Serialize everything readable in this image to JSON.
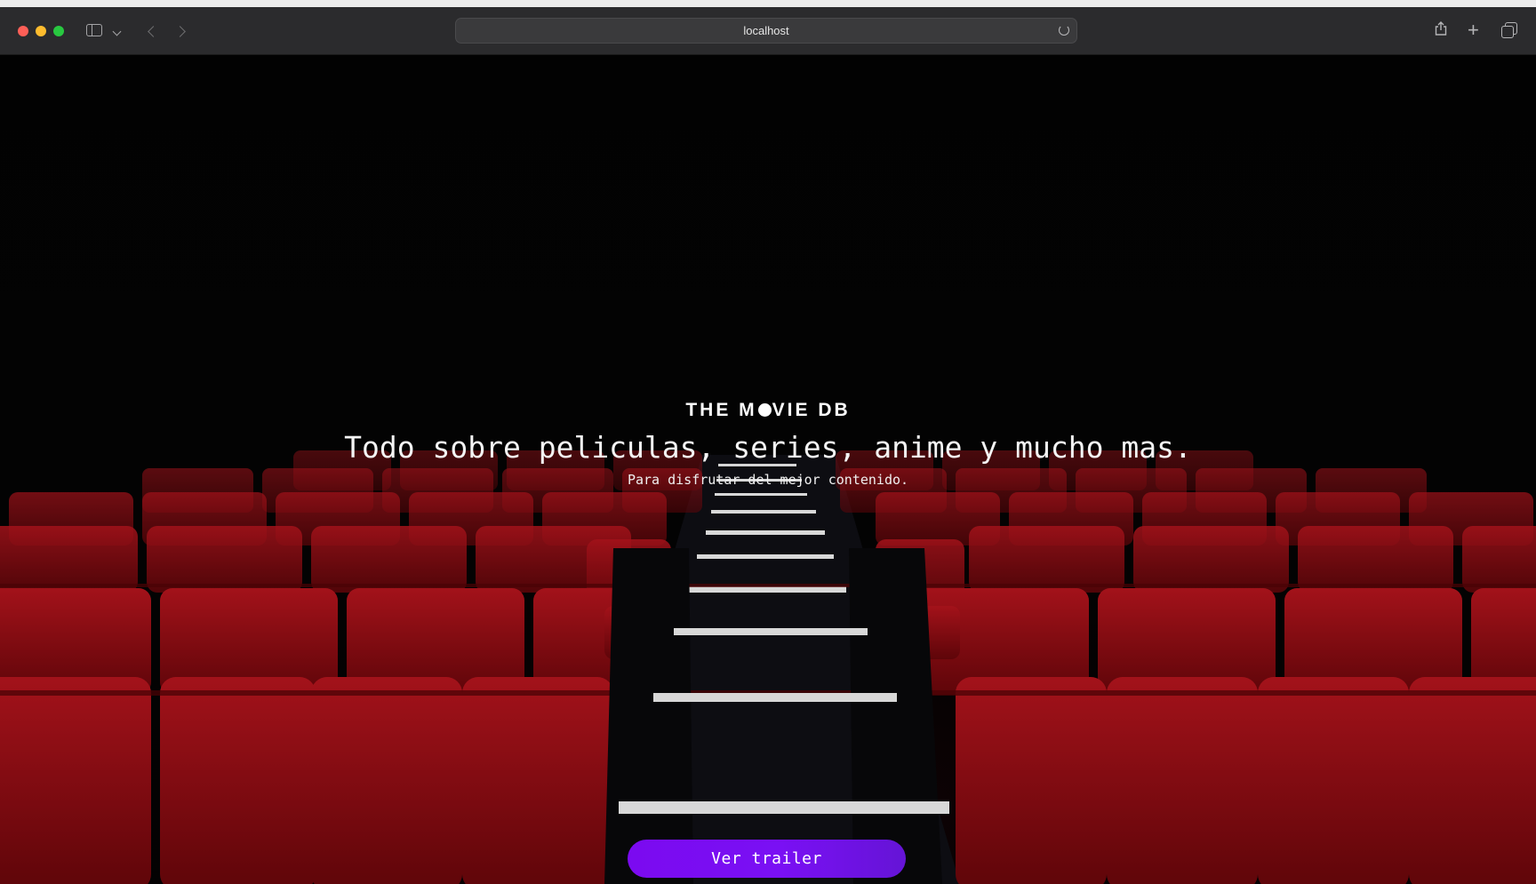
{
  "browser": {
    "address": "localhost",
    "icons": [
      "sidebar-icon",
      "chevron-down-icon",
      "back-icon",
      "forward-icon",
      "reload-icon",
      "share-icon",
      "plus-icon",
      "tabs-icon"
    ]
  },
  "hero": {
    "brand_left": "THE M",
    "brand_right": "VIE DB",
    "tagline": "Todo sobre peliculas, series, anime y mucho mas.",
    "subtitle": "Para disfrutar del mejor contenido.",
    "button_label": "Ver trailer",
    "button_color": "#7b0af0",
    "seat_color": "#8c0a10"
  }
}
